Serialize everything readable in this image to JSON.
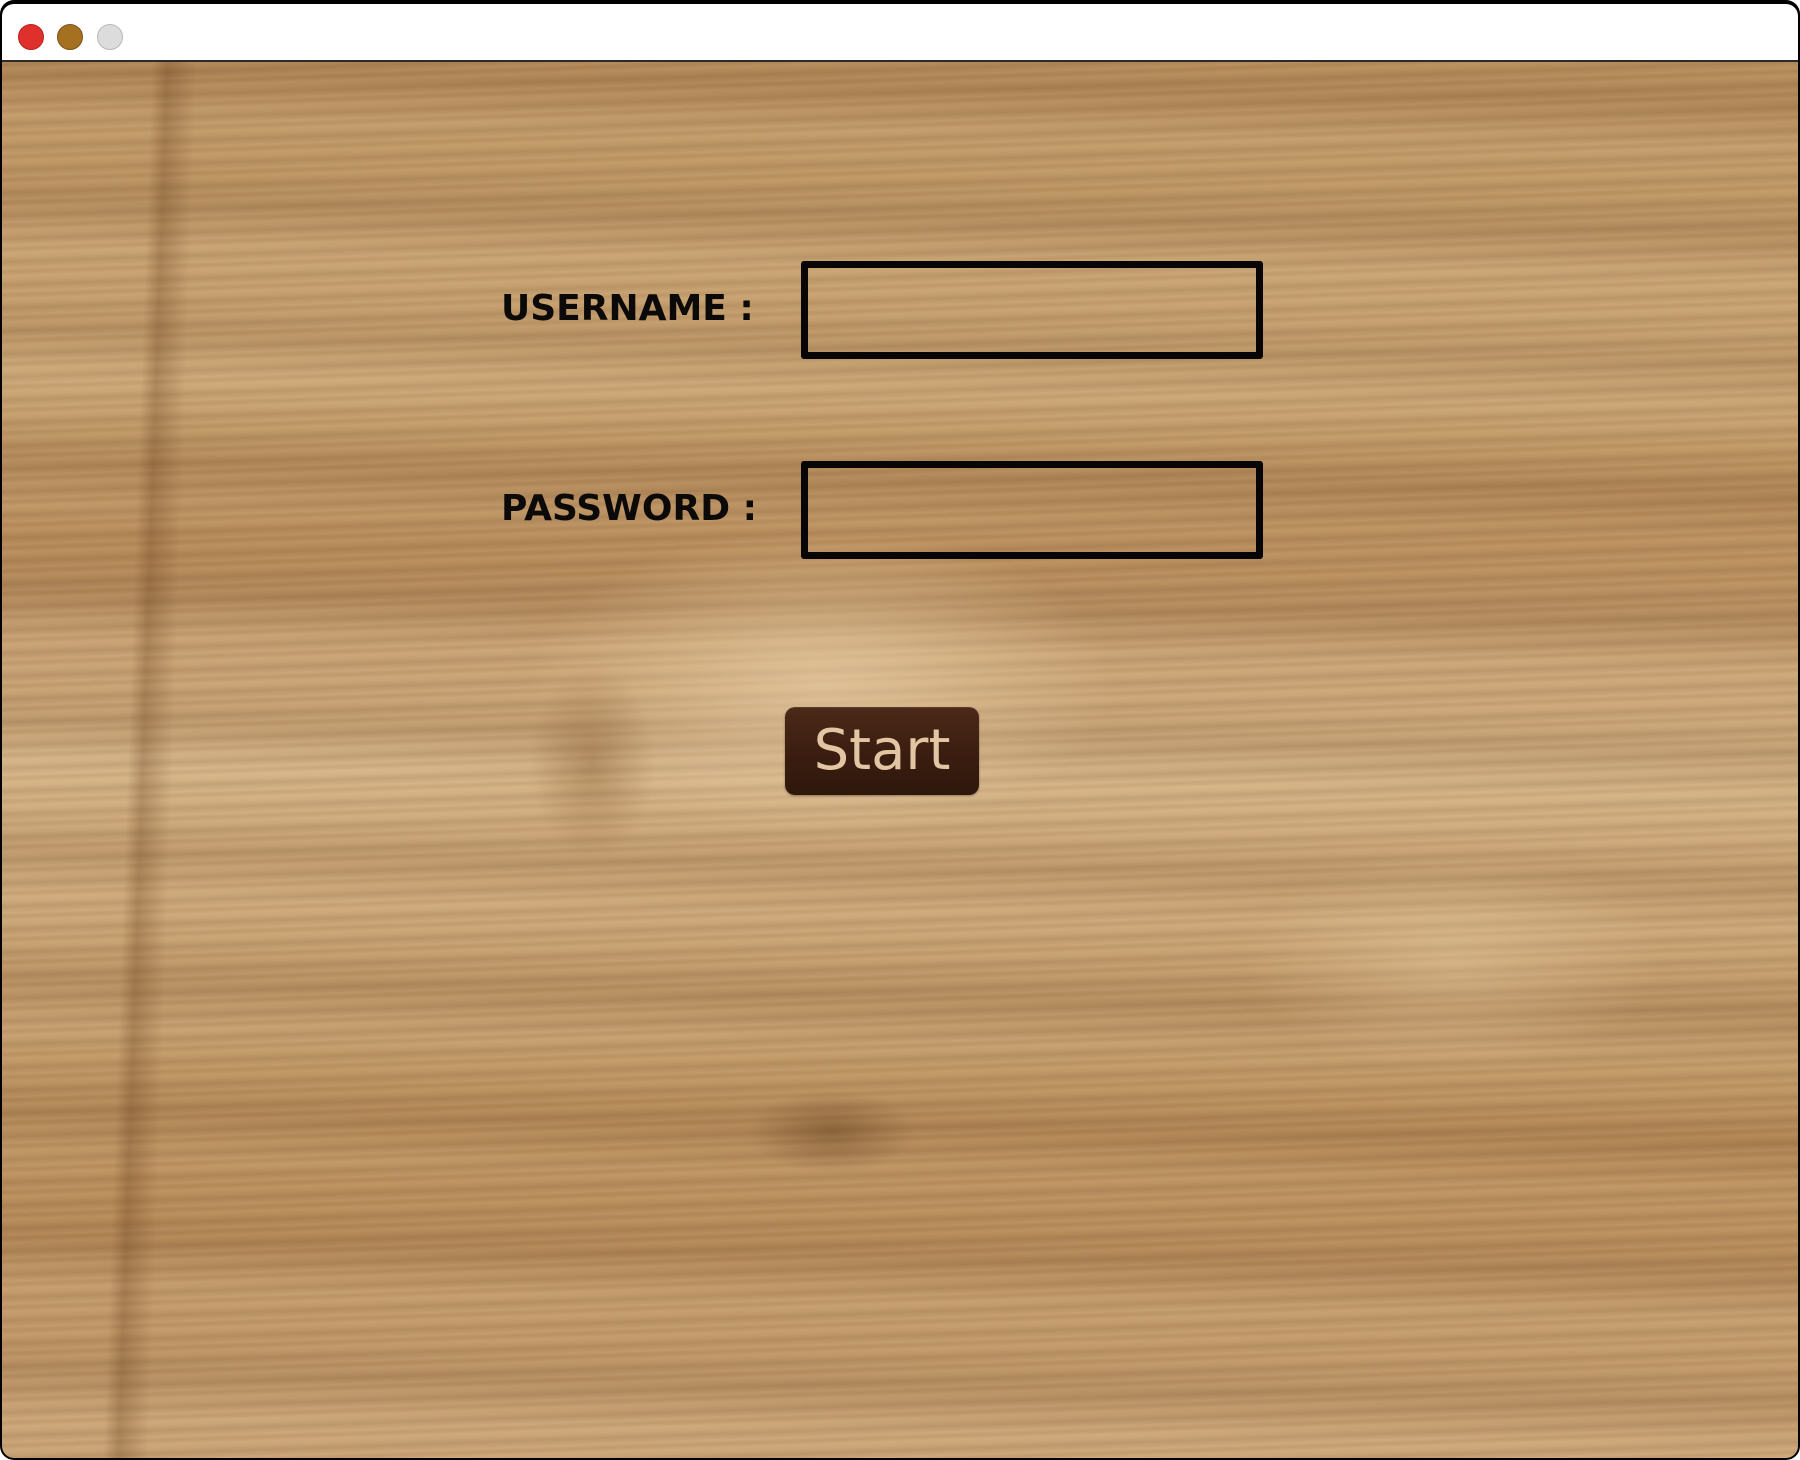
{
  "window": {
    "traffic_lights": {
      "close_color": "#e0302c",
      "minimize_color": "#a57020",
      "zoom_color": "#dcdcdc"
    }
  },
  "form": {
    "username_label": "USERNAME :",
    "username_value": "",
    "password_label": "PASSWORD :",
    "password_value": "",
    "start_label": "Start"
  },
  "colors": {
    "background": "#c39c6c",
    "field_border": "#070605",
    "button_bg": "#3a1d10",
    "button_text": "#e2c6a3"
  }
}
